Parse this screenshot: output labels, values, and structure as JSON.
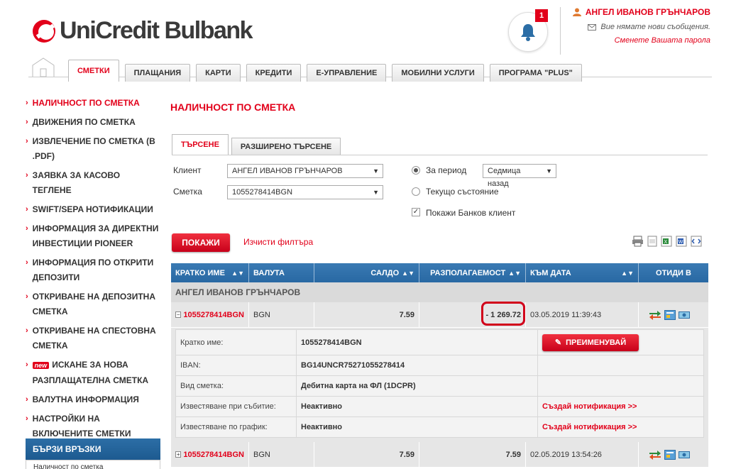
{
  "header": {
    "logo_text": "UniCredit Bulbank",
    "notification_count": "1",
    "user_name": "АНГЕЛ ИВАНОВ ГРЪНЧАРОВ",
    "messages_text": "Вие нямате нови съобщения.",
    "change_password": "Сменете Вашата парола"
  },
  "nav": {
    "tabs": [
      "СМЕТКИ",
      "ПЛАЩАНИЯ",
      "КАРТИ",
      "КРЕДИТИ",
      "Е-УПРАВЛЕНИЕ",
      "МОБИЛНИ УСЛУГИ",
      "ПРОГРАМА \"PLUS\""
    ],
    "active": "СМЕТКИ"
  },
  "sidebar": {
    "items": [
      "НАЛИЧНОСТ ПО СМЕТКА",
      "ДВИЖЕНИЯ ПО СМЕТКА",
      "ИЗВЛЕЧЕНИЕ ПО СМЕТКА (В .PDF)",
      "ЗАЯВКА ЗА КАСОВО ТЕГЛЕНЕ",
      "SWIFT/SEPA НОТИФИКАЦИИ",
      "ИНФОРМАЦИЯ ЗА ДИРЕКТНИ ИНВЕСТИЦИИ PIONEER",
      "ИНФОРМАЦИЯ ПО ОТКРИТИ ДЕПОЗИТИ",
      "ОТКРИВАНЕ НА ДЕПОЗИТНА СМЕТКА",
      "ОТКРИВАНЕ НА СПЕСТОВНА СМЕТКА",
      "ИСКАНЕ ЗА НОВА РАЗПЛАЩАТЕЛНА СМЕТКА",
      "ВАЛУТНА ИНФОРМАЦИЯ",
      "НАСТРОЙКИ НА ВКЛЮЧЕНИТЕ СМЕТКИ"
    ],
    "new_badge": "new",
    "quick_links_title": "БЪРЗИ ВРЪЗКИ",
    "quick_links_first": "Наличност по сметка"
  },
  "main": {
    "page_title": "НАЛИЧНОСТ ПО СМЕТКА",
    "search_tabs": [
      "ТЪРСЕНЕ",
      "РАЗШИРЕНО ТЪРСЕНЕ"
    ],
    "filters": {
      "client_label": "Клиент",
      "client_value": "АНГЕЛ ИВАНОВ ГРЪНЧАРОВ",
      "account_label": "Сметка",
      "account_value": "1055278414BGN",
      "period_label": "За период",
      "period_value": "Седмица назад",
      "current_label": "Текущо състояние",
      "show_bank_client_label": "Покажи Банков клиент",
      "period_selected": true,
      "show_bank_client_checked": true
    },
    "show_button": "ПОКАЖИ",
    "clear_filters": "Изчисти филтъра"
  },
  "table": {
    "headers": [
      "КРАТКО ИМЕ",
      "ВАЛУТА",
      "САЛДО",
      "РАЗПОЛАГАЕМОСТ",
      "КЪМ ДАТА",
      "ОТИДИ В"
    ],
    "group_name": "АНГЕЛ ИВАНОВ ГРЪНЧАРОВ",
    "rows": [
      {
        "name": "1055278414BGN",
        "currency": "BGN",
        "balance": "7.59",
        "available": "- 1 269.72",
        "date": "03.05.2019 11:39:43",
        "expanded": true
      },
      {
        "name": "1055278414BGN",
        "currency": "BGN",
        "balance": "7.59",
        "available": "7.59",
        "date": "02.05.2019 13:54:26",
        "expanded": false
      }
    ],
    "details": {
      "short_name_label": "Кратко име:",
      "short_name_value": "1055278414BGN",
      "rename_button": "ПРЕИМЕНУВАЙ",
      "iban_label": "IBAN:",
      "iban_value": "BG14UNCR75271055278414",
      "account_type_label": "Вид сметка:",
      "account_type_value": "Дебитна карта на ФЛ  (1DCPR)",
      "event_notify_label": "Известяване при събитие:",
      "event_notify_value": "Неактивно",
      "event_notify_link": "Създай нотификация >>",
      "schedule_notify_label": "Известяване по график:",
      "schedule_notify_value": "Неактивно",
      "schedule_notify_link": "Създай нотификация >>"
    }
  },
  "colors": {
    "brand_red": "#e2001a",
    "table_header_blue": "#2f70ab",
    "sidebar_box_blue": "#2c6ea6"
  }
}
